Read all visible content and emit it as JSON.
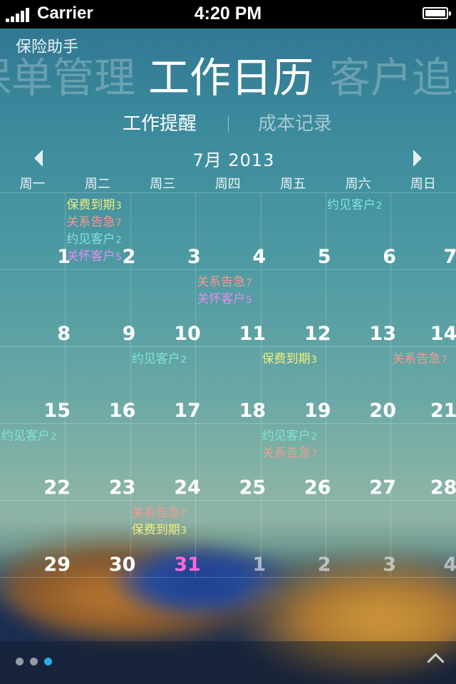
{
  "status_bar": {
    "carrier": "Carrier",
    "time": "4:20 PM"
  },
  "app": {
    "title": "保险助手"
  },
  "sections": {
    "prev": "保单管理",
    "current": "工作日历",
    "next": "客户追踪"
  },
  "subtabs": {
    "active": "工作提醒",
    "inactive": "成本记录"
  },
  "calendar": {
    "month_label": "7月  2013",
    "weekdays": [
      "周一",
      "周二",
      "周三",
      "周四",
      "周五",
      "周六",
      "周日"
    ],
    "weeks": [
      [
        {
          "day": "1",
          "events": []
        },
        {
          "day": "2",
          "events": [
            {
              "label": "保费到期",
              "count": "3",
              "color": "yellow"
            },
            {
              "label": "关系告急",
              "count": "7",
              "color": "pink"
            },
            {
              "label": "约见客户",
              "count": "2",
              "color": "cyan"
            },
            {
              "label": "关怀客户",
              "count": "5",
              "color": "purple"
            }
          ]
        },
        {
          "day": "3",
          "events": []
        },
        {
          "day": "4",
          "events": []
        },
        {
          "day": "5",
          "events": []
        },
        {
          "day": "6",
          "events": [
            {
              "label": "约见客户",
              "count": "2",
              "color": "cyan"
            }
          ]
        },
        {
          "day": "7",
          "events": []
        }
      ],
      [
        {
          "day": "8",
          "events": []
        },
        {
          "day": "9",
          "events": []
        },
        {
          "day": "10",
          "events": []
        },
        {
          "day": "11",
          "events": [
            {
              "label": "关系告急",
              "count": "7",
              "color": "pink"
            },
            {
              "label": "关怀客户",
              "count": "5",
              "color": "purple"
            }
          ]
        },
        {
          "day": "12",
          "events": []
        },
        {
          "day": "13",
          "events": []
        },
        {
          "day": "14",
          "events": []
        }
      ],
      [
        {
          "day": "15",
          "events": []
        },
        {
          "day": "16",
          "events": []
        },
        {
          "day": "17",
          "events": [
            {
              "label": "约见客户",
              "count": "2",
              "color": "cyan"
            }
          ]
        },
        {
          "day": "18",
          "events": []
        },
        {
          "day": "19",
          "events": [
            {
              "label": "保费到期",
              "count": "3",
              "color": "yellow"
            }
          ]
        },
        {
          "day": "20",
          "events": []
        },
        {
          "day": "21",
          "events": [
            {
              "label": "关系告急",
              "count": "7",
              "color": "pink"
            }
          ]
        }
      ],
      [
        {
          "day": "22",
          "events": [
            {
              "label": "约见客户",
              "count": "2",
              "color": "cyan"
            }
          ]
        },
        {
          "day": "23",
          "events": []
        },
        {
          "day": "24",
          "events": []
        },
        {
          "day": "25",
          "events": []
        },
        {
          "day": "26",
          "events": [
            {
              "label": "约见客户",
              "count": "2",
              "color": "cyan"
            },
            {
              "label": "关系告急",
              "count": "7",
              "color": "pink"
            }
          ]
        },
        {
          "day": "27",
          "events": []
        },
        {
          "day": "28",
          "events": []
        }
      ],
      [
        {
          "day": "29",
          "events": []
        },
        {
          "day": "30",
          "events": []
        },
        {
          "day": "31",
          "today": true,
          "events": [
            {
              "label": "关系告急",
              "count": "7",
              "color": "pink"
            },
            {
              "label": "保费到期",
              "count": "3",
              "color": "yellow"
            }
          ]
        },
        {
          "day": "1",
          "other": true,
          "events": []
        },
        {
          "day": "2",
          "other": true,
          "events": []
        },
        {
          "day": "3",
          "other": true,
          "events": []
        },
        {
          "day": "4",
          "other": true,
          "events": []
        }
      ]
    ]
  },
  "colors": {
    "today": "#ff69d9",
    "yellow": "#f2ef7a",
    "pink": "#f49a8e",
    "cyan": "#7fe6d5",
    "purple": "#e68cf0",
    "page_dot_active": "#27aee8"
  },
  "pager": {
    "count": 3,
    "active_index": 2
  },
  "icons": {
    "signal": "signal-bars-icon",
    "battery": "battery-icon",
    "prev_month": "triangle-left-icon",
    "next_month": "triangle-right-icon",
    "expand": "chevron-up-icon"
  }
}
